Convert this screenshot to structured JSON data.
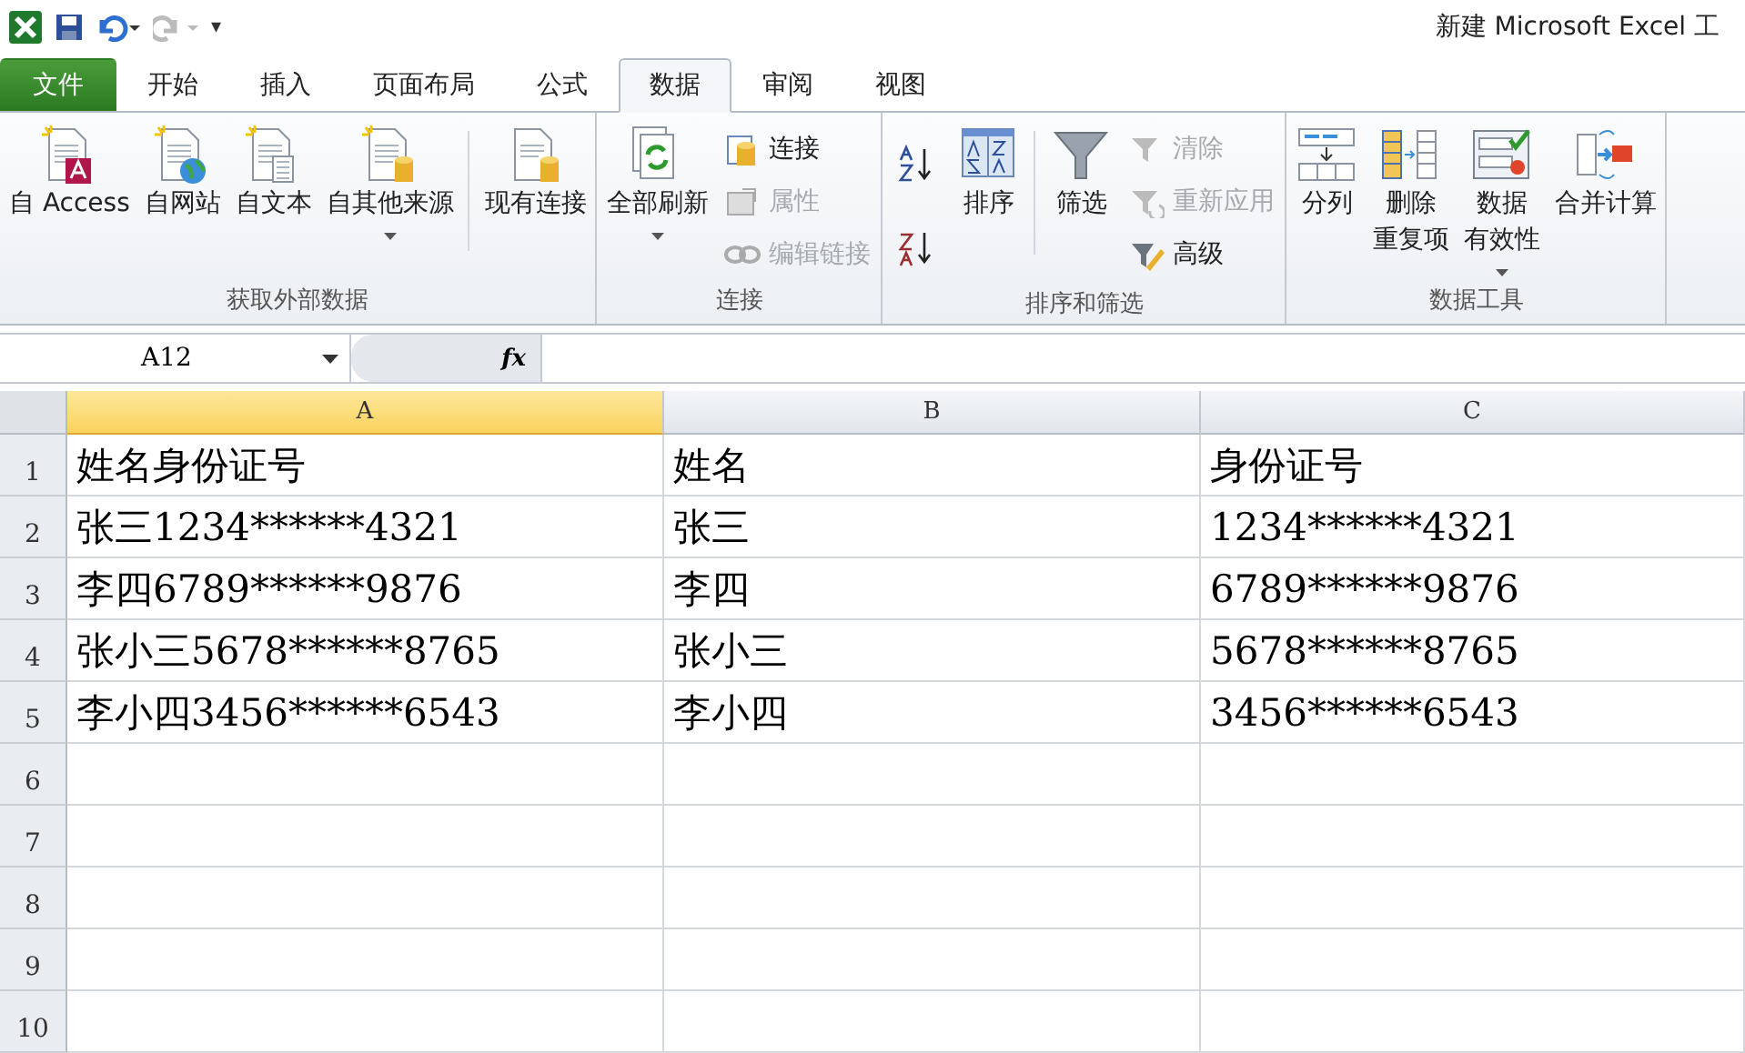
{
  "window": {
    "title": "新建 Microsoft Excel 工"
  },
  "quick_access": {
    "more": "▾"
  },
  "tabs": [
    {
      "label": "文件",
      "kind": "file",
      "selected": false
    },
    {
      "label": "开始",
      "kind": "tab",
      "selected": false
    },
    {
      "label": "插入",
      "kind": "tab",
      "selected": false
    },
    {
      "label": "页面布局",
      "kind": "tab",
      "selected": false
    },
    {
      "label": "公式",
      "kind": "tab",
      "selected": false
    },
    {
      "label": "数据",
      "kind": "tab",
      "selected": true
    },
    {
      "label": "审阅",
      "kind": "tab",
      "selected": false
    },
    {
      "label": "视图",
      "kind": "tab",
      "selected": false
    }
  ],
  "ribbon": {
    "groups": [
      {
        "label": "获取外部数据",
        "columns": [
          {
            "kind": "large",
            "lines": [
              "自 Access"
            ],
            "dropdown": false
          },
          {
            "kind": "large",
            "lines": [
              "自网站"
            ],
            "dropdown": false
          },
          {
            "kind": "large",
            "lines": [
              "自文本"
            ],
            "dropdown": false
          },
          {
            "kind": "large",
            "lines": [
              "自其他来源"
            ],
            "dropdown": true
          },
          {
            "kind": "separator"
          },
          {
            "kind": "large",
            "lines": [
              "现有连接"
            ],
            "dropdown": false
          }
        ]
      },
      {
        "label": "连接",
        "columns": [
          {
            "kind": "large",
            "lines": [
              "全部刷新"
            ],
            "dropdown": true
          },
          {
            "kind": "stack",
            "items": [
              {
                "label": "连接",
                "disabled": false
              },
              {
                "label": "属性",
                "disabled": true
              },
              {
                "label": "编辑链接",
                "disabled": true
              }
            ]
          }
        ]
      },
      {
        "label": "排序和筛选",
        "columns": [
          {
            "kind": "sortpair"
          },
          {
            "kind": "large",
            "lines": [
              "排序"
            ],
            "dropdown": false
          },
          {
            "kind": "separator"
          },
          {
            "kind": "large",
            "lines": [
              "筛选"
            ],
            "dropdown": false
          },
          {
            "kind": "stack",
            "items": [
              {
                "label": "清除",
                "disabled": true
              },
              {
                "label": "重新应用",
                "disabled": true
              },
              {
                "label": "高级",
                "disabled": false
              }
            ]
          }
        ]
      },
      {
        "label": "数据工具",
        "columns": [
          {
            "kind": "large",
            "lines": [
              "分列"
            ],
            "dropdown": false
          },
          {
            "kind": "large",
            "lines": [
              "删除",
              "重复项"
            ],
            "dropdown": false
          },
          {
            "kind": "large",
            "lines": [
              "数据",
              "有效性"
            ],
            "dropdown": true
          },
          {
            "kind": "large",
            "lines": [
              "合并计算"
            ],
            "dropdown": false
          }
        ]
      }
    ]
  },
  "formula_bar": {
    "name_box": "A12",
    "fx": "fx"
  },
  "sheet": {
    "columns": [
      {
        "label": "A",
        "selected": true
      },
      {
        "label": "B",
        "selected": false
      },
      {
        "label": "C",
        "selected": false
      }
    ],
    "rows": [
      {
        "number": "1",
        "cells": [
          "姓名身份证号",
          "姓名",
          "身份证号"
        ]
      },
      {
        "number": "2",
        "cells": [
          "张三1234******4321",
          "张三",
          "1234******4321"
        ]
      },
      {
        "number": "3",
        "cells": [
          "李四6789******9876",
          "李四",
          "6789******9876"
        ]
      },
      {
        "number": "4",
        "cells": [
          "张小三5678******8765",
          "张小三",
          "5678******8765"
        ]
      },
      {
        "number": "5",
        "cells": [
          "李小四3456******6543",
          "李小四",
          "3456******6543"
        ]
      },
      {
        "number": "6",
        "cells": [
          "",
          "",
          ""
        ]
      },
      {
        "number": "7",
        "cells": [
          "",
          "",
          ""
        ]
      },
      {
        "number": "8",
        "cells": [
          "",
          "",
          ""
        ]
      },
      {
        "number": "9",
        "cells": [
          "",
          "",
          ""
        ]
      },
      {
        "number": "10",
        "cells": [
          "",
          "",
          ""
        ]
      }
    ]
  }
}
